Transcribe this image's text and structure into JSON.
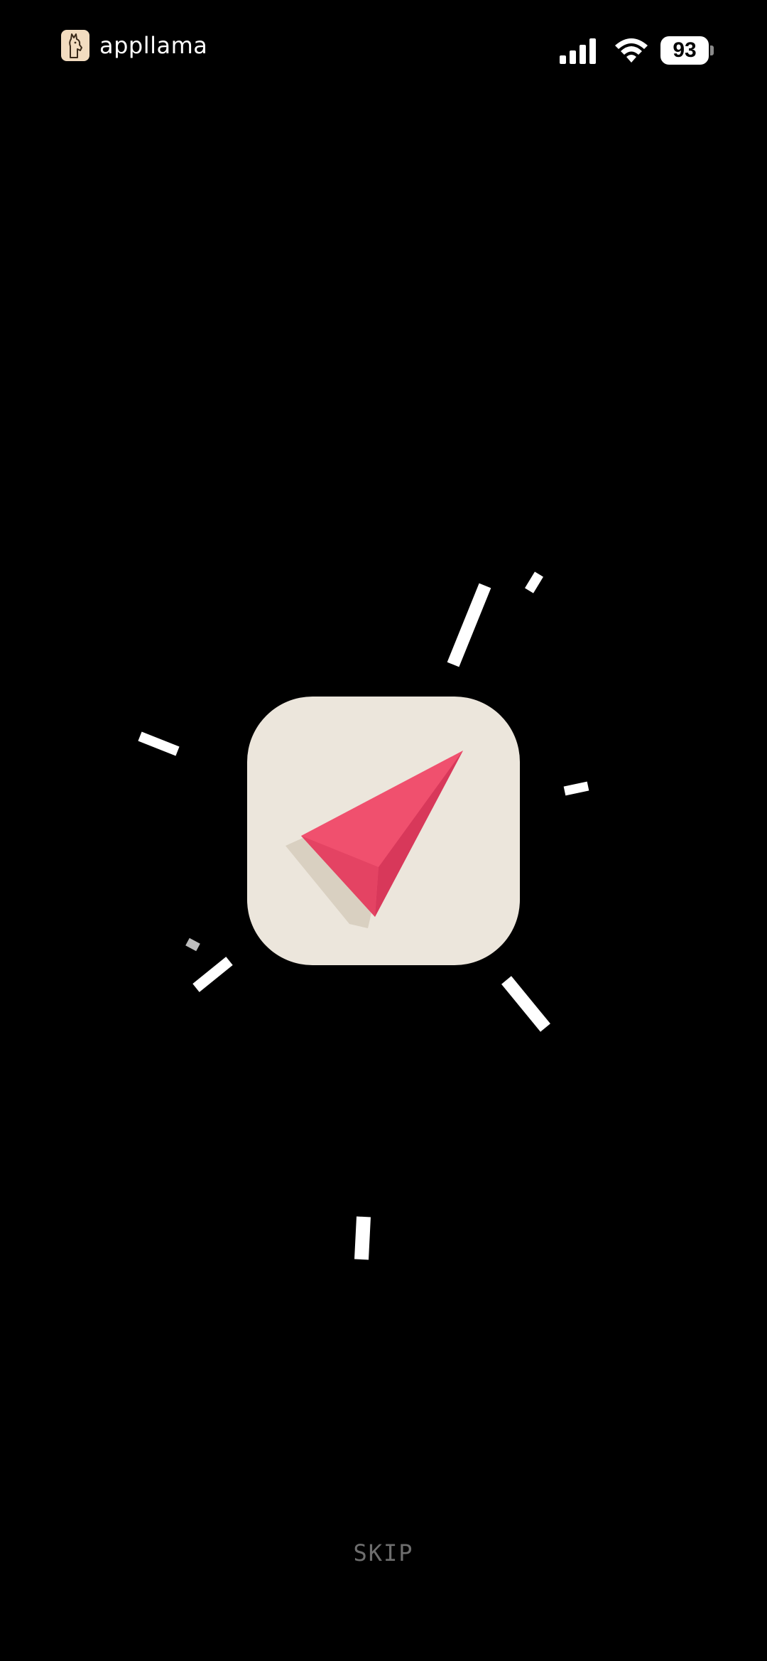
{
  "status_bar": {
    "brand_name": "appllama",
    "battery_level": "93",
    "signal_icon": "cellular-signal-icon",
    "wifi_icon": "wifi-icon",
    "battery_icon": "battery-icon"
  },
  "splash": {
    "app_icon": "paper-plane-arrow-icon",
    "icon_background_color": "#ece6dc",
    "arrow_color": "#f0506e",
    "arrow_shadow_color": "#d9d0c1",
    "burst_color": "#ffffff"
  },
  "footer": {
    "skip_label": "SKIP"
  }
}
